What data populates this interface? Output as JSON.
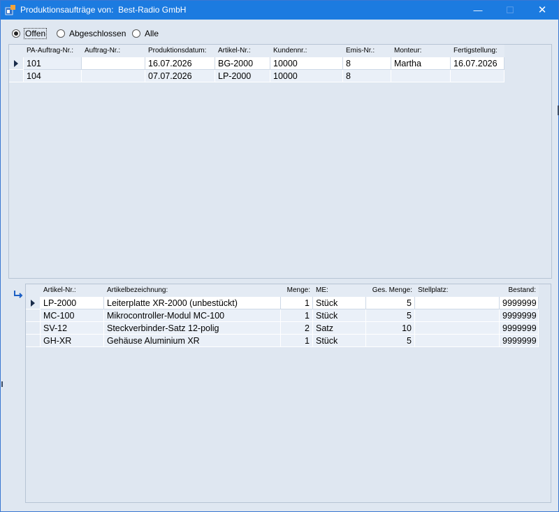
{
  "window": {
    "title": "Produktionsaufträge von:  Best-Radio GmbH"
  },
  "titlebar": {
    "minimize": "—",
    "maximize": "☐",
    "close": "✕"
  },
  "filter": {
    "options": [
      "Offen",
      "Abgeschlossen",
      "Alle"
    ],
    "selected": "Offen"
  },
  "orders": {
    "columns": [
      "PA-Auftrag-Nr.:",
      "Auftrag-Nr.:",
      "Produktionsdatum:",
      "Artikel-Nr.:",
      "Kundennr.:",
      "Emis-Nr.:",
      "Monteur:",
      "Fertigstellung:"
    ],
    "rows": [
      [
        "101",
        "",
        "16.07.2026",
        "BG-2000",
        "10000",
        "8",
        "Martha",
        "16.07.2026"
      ],
      [
        "104",
        "",
        "07.07.2026",
        "LP-2000",
        "10000",
        "8",
        "",
        ""
      ]
    ]
  },
  "items": {
    "columns": [
      "Artikel-Nr.:",
      "Artikelbezeichnung:",
      "Menge:",
      "ME:",
      "Ges. Menge:",
      "Stellplatz:",
      "Bestand:"
    ],
    "rows": [
      [
        "LP-2000",
        "Leiterplatte XR-2000 (unbestückt)",
        "1",
        "Stück",
        "5",
        "",
        "9999999"
      ],
      [
        "MC-100",
        "Mikrocontroller-Modul MC-100",
        "1",
        "Stück",
        "5",
        "",
        "9999999"
      ],
      [
        "SV-12",
        "Steckverbinder-Satz 12-polig",
        "2",
        "Satz",
        "10",
        "",
        "9999999"
      ],
      [
        "GH-XR",
        "Gehäuse Aluminium XR",
        "1",
        "Stück",
        "5",
        "",
        "9999999"
      ]
    ]
  },
  "colors": {
    "titlebar": "#1c7be0",
    "background": "#dfe7f1"
  },
  "icons": {
    "app": "app-icon",
    "link": "subform-link-icon",
    "row_selector": "record-selector-arrow-icon"
  }
}
